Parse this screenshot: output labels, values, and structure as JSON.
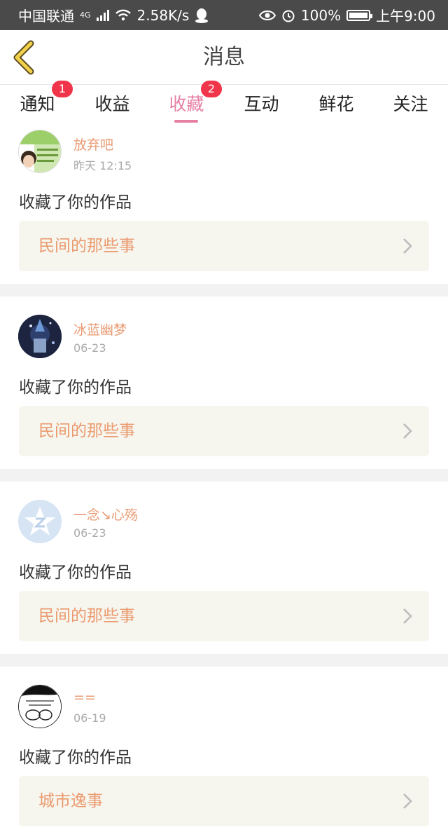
{
  "status_bar": {
    "carrier": "中国联通",
    "network": "4G",
    "speed": "2.58K/s",
    "battery": "100%",
    "time": "上午9:00"
  },
  "nav": {
    "title": "消息",
    "back_icon": "chevron-left-icon"
  },
  "tabs": [
    {
      "label": "通知",
      "badge": "1"
    },
    {
      "label": "收益",
      "badge": ""
    },
    {
      "label": "收藏",
      "badge": "2",
      "active": true
    },
    {
      "label": "互动",
      "badge": ""
    },
    {
      "label": "鲜花",
      "badge": ""
    },
    {
      "label": "关注",
      "badge": ""
    }
  ],
  "colors": {
    "accent": "#e57fa4",
    "username": "#e89b73",
    "work_title": "#eb9a6e",
    "badge": "#f0344a"
  },
  "messages": [
    {
      "user": "放弃吧",
      "time": "昨天 12:15",
      "action": "收藏了你的作品",
      "work": "民间的那些事"
    },
    {
      "user": "冰蓝幽梦",
      "time": "06-23",
      "action": "收藏了你的作品",
      "work": "民间的那些事"
    },
    {
      "user": "一念↘心殇",
      "time": "06-23",
      "action": "收藏了你的作品",
      "work": "民间的那些事"
    },
    {
      "user": "==",
      "time": "06-19",
      "action": "收藏了你的作品",
      "work": "城市逸事"
    }
  ]
}
